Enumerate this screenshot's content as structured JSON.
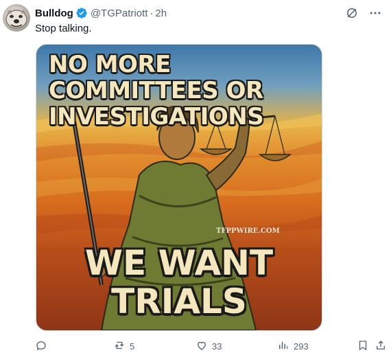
{
  "tweet": {
    "display_name": "Bulldog",
    "handle": "@TGPatriott",
    "separator": "·",
    "time": "2h",
    "text": "Stop talking.",
    "image": {
      "headline_top": "NO MORE COMMITTEES OR INVESTIGATIONS",
      "headline_bottom_line1": "WE WANT",
      "headline_bottom_line2": "TRIALS",
      "watermark": "TFPPWIRE.COM"
    },
    "actions": {
      "reply_count": "",
      "retweet_count": "5",
      "like_count": "33",
      "views_count": "293"
    }
  },
  "icons": {
    "verified": "verified-badge-icon",
    "grok": "grok-icon",
    "more": "more-icon",
    "reply": "reply-icon",
    "retweet": "retweet-icon",
    "like": "heart-icon",
    "views": "views-icon",
    "bookmark": "bookmark-icon",
    "share": "share-icon"
  },
  "colors": {
    "verified_blue": "#1d9bf0",
    "secondary_text": "#536471",
    "primary_text": "#0f1419"
  }
}
